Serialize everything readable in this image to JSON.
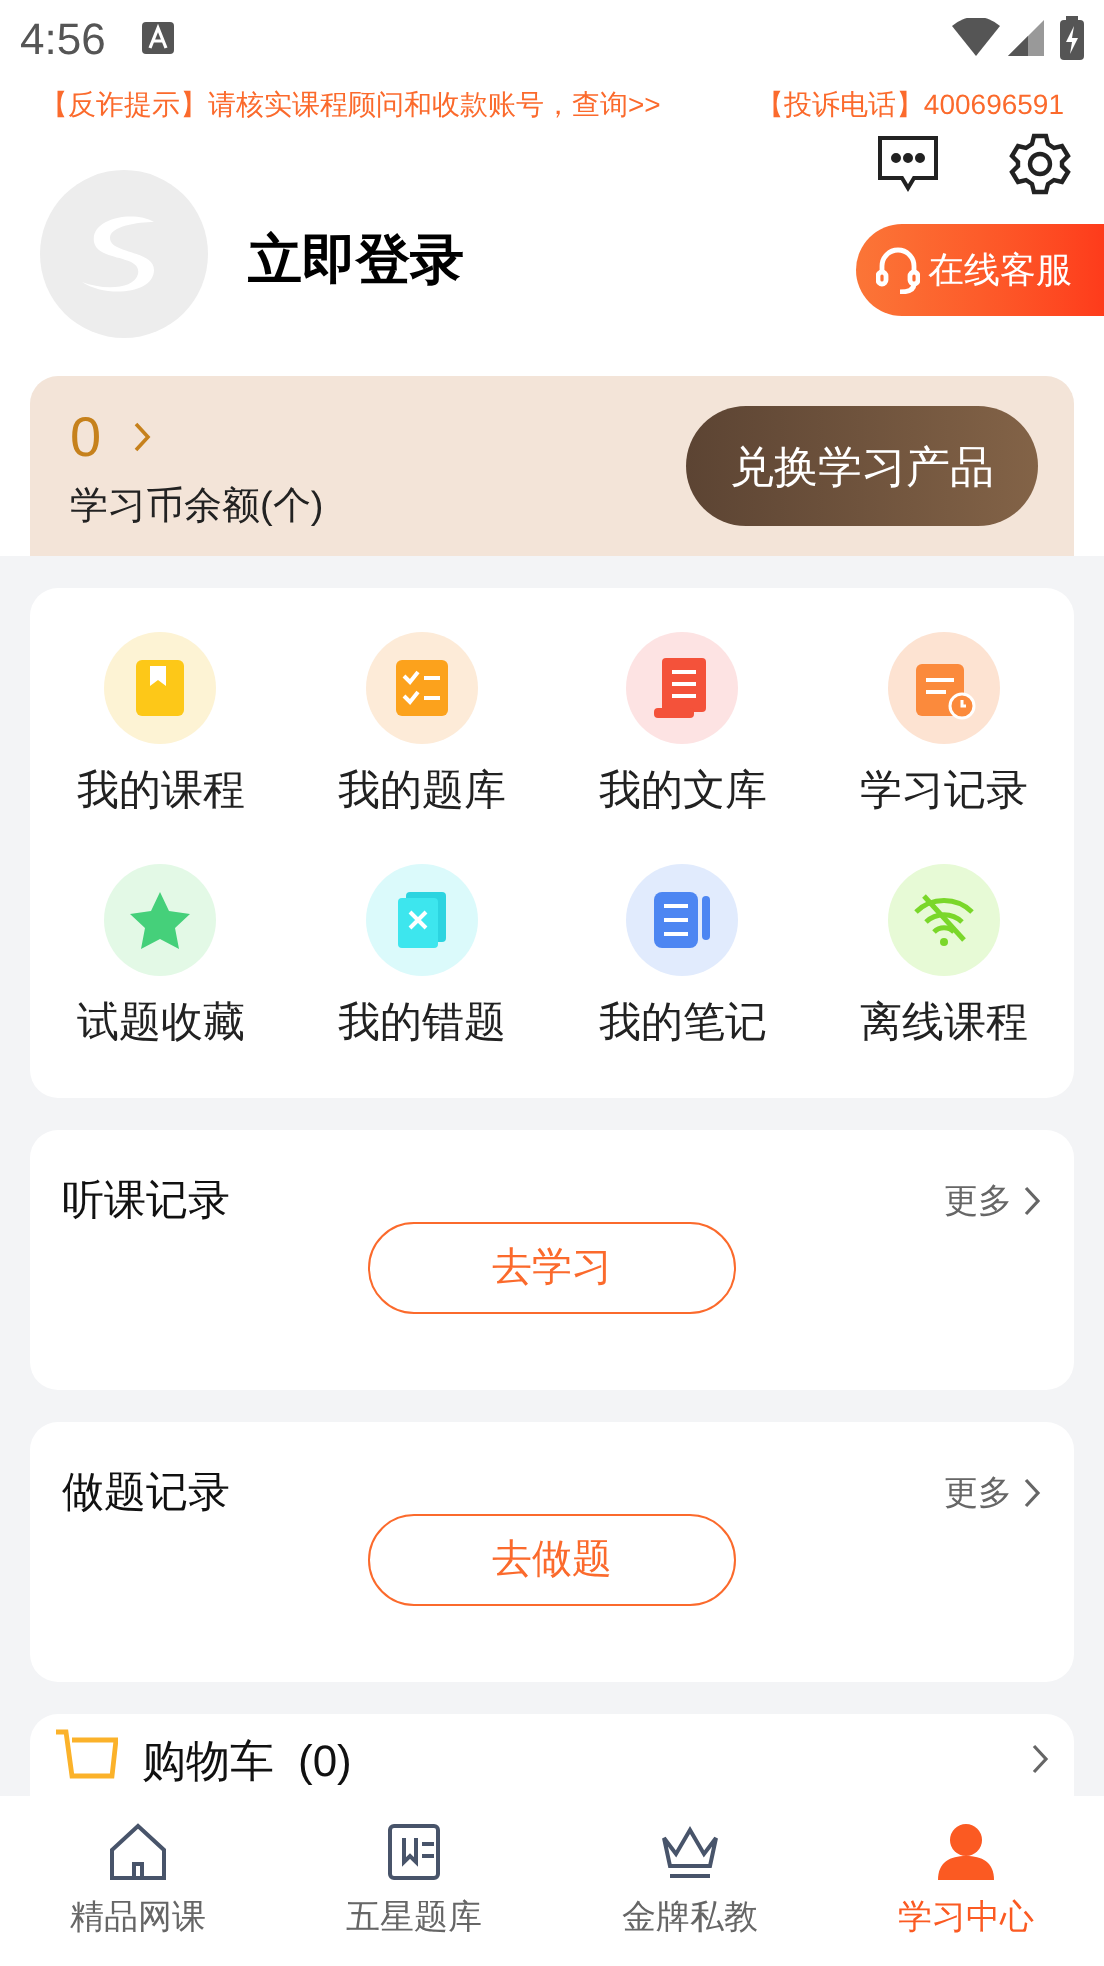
{
  "status_bar": {
    "time": "4:56"
  },
  "notice": {
    "warning": "【反诈提示】请核实课程顾问和收款账号，查询>>",
    "complaint": "【投诉电话】400696591"
  },
  "profile": {
    "login": "立即登录",
    "service_button": "在线客服"
  },
  "coins": {
    "count": "0",
    "label": "学习币余额(个)",
    "button": "兑换学习产品"
  },
  "shortcuts": [
    {
      "label": "我的课程"
    },
    {
      "label": "我的题库"
    },
    {
      "label": "我的文库"
    },
    {
      "label": "学习记录"
    },
    {
      "label": "试题收藏"
    },
    {
      "label": "我的错题"
    },
    {
      "label": "我的笔记"
    },
    {
      "label": "离线课程"
    }
  ],
  "records": [
    {
      "title": "听课记录",
      "more": "更多",
      "button": "去学习"
    },
    {
      "title": "做题记录",
      "more": "更多",
      "button": "去做题"
    }
  ],
  "cart": {
    "label": "购物车",
    "count": "(0)"
  },
  "tab_bar": [
    {
      "label": "精品网课",
      "selected": false
    },
    {
      "label": "五星题库",
      "selected": false
    },
    {
      "label": "金牌私教",
      "selected": false
    },
    {
      "label": "学习中心",
      "selected": true
    }
  ]
}
